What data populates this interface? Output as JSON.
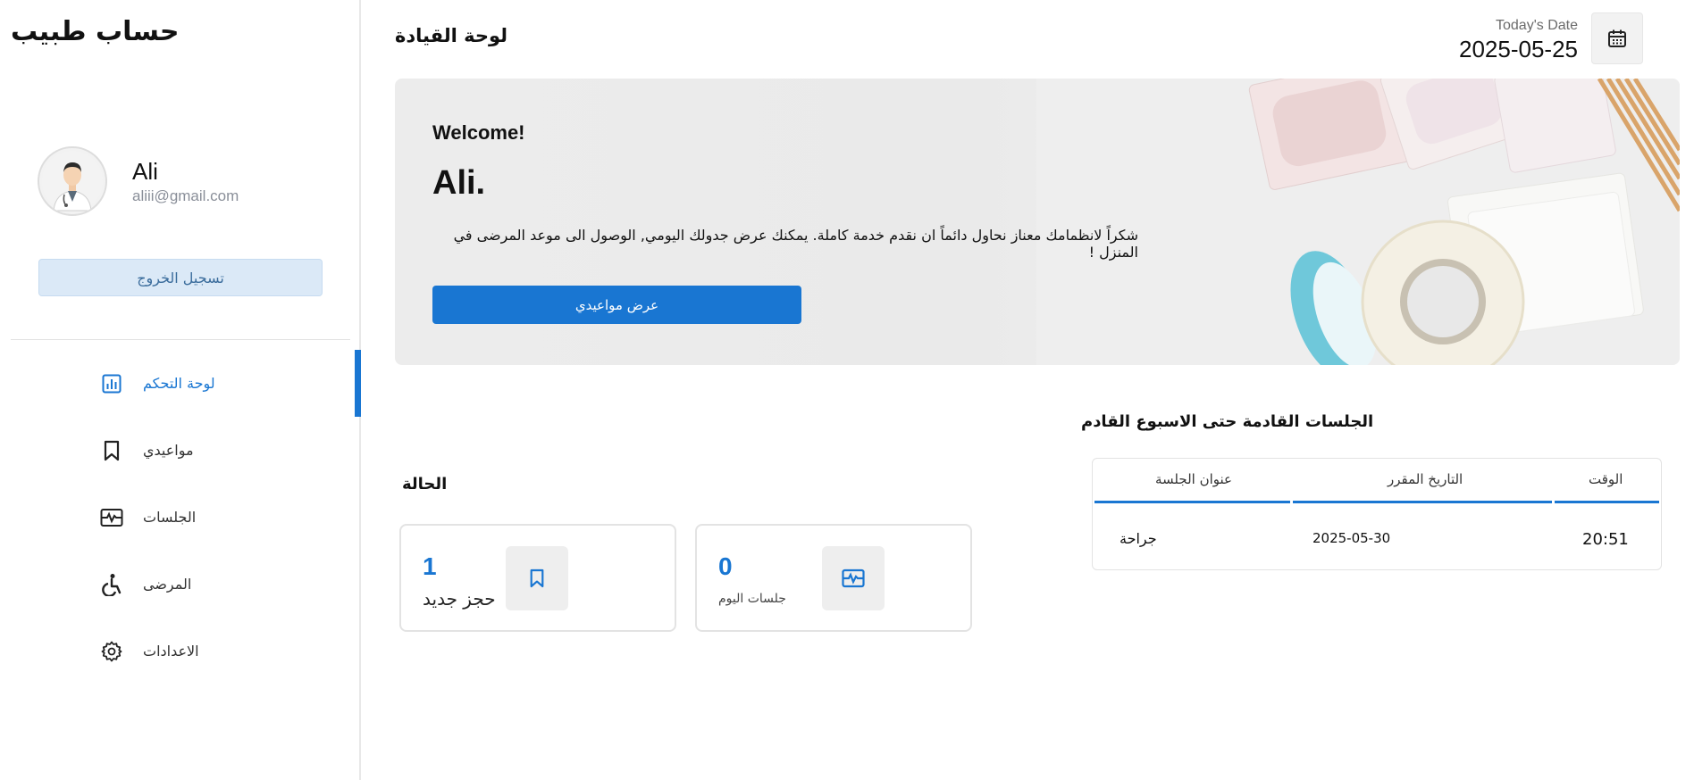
{
  "sidebar": {
    "brand": "حساب طبيب",
    "profile": {
      "name": "Ali",
      "email": "aliii@gmail.com"
    },
    "logout_label": "تسجيل الخروج",
    "items": [
      {
        "label": "لوحة التحكم",
        "icon": "dashboard-chart-icon",
        "active": true
      },
      {
        "label": "مواعيدي",
        "icon": "bookmark-icon",
        "active": false
      },
      {
        "label": "الجلسات",
        "icon": "activity-monitor-icon",
        "active": false
      },
      {
        "label": "المرضى",
        "icon": "wheelchair-icon",
        "active": false
      },
      {
        "label": "الاعدادات",
        "icon": "gear-icon",
        "active": false
      }
    ]
  },
  "header": {
    "title": "لوحة القيادة",
    "date_label": "Today's Date",
    "date_value": "2025-05-25"
  },
  "hero": {
    "welcome": "Welcome!",
    "name": "Ali.",
    "message": "شكراً لانظمامك معناز نحاول دائماً ان نقدم خدمة كاملة. يمكنك عرض جدولك اليومي, الوصول الى موعد المرضى في المنزل !",
    "button_label": "عرض مواعيدي"
  },
  "status": {
    "title": "الحالة",
    "cards": [
      {
        "value": "1",
        "label": "حجز جديد",
        "icon": "bookmark-icon"
      },
      {
        "value": "0",
        "label": "جلسات اليوم",
        "icon": "activity-monitor-icon"
      }
    ]
  },
  "sessions": {
    "title": "الجلسات القادمة حتى الاسبوع القادم",
    "columns": [
      "عنوان الجلسة",
      "التاريخ المقرر",
      "الوقت"
    ],
    "rows": [
      {
        "title": "جراحة",
        "date": "2025-05-30",
        "time": "20:51"
      }
    ]
  },
  "colors": {
    "accent": "#1976d2",
    "logout_bg": "#dbe9f7"
  }
}
